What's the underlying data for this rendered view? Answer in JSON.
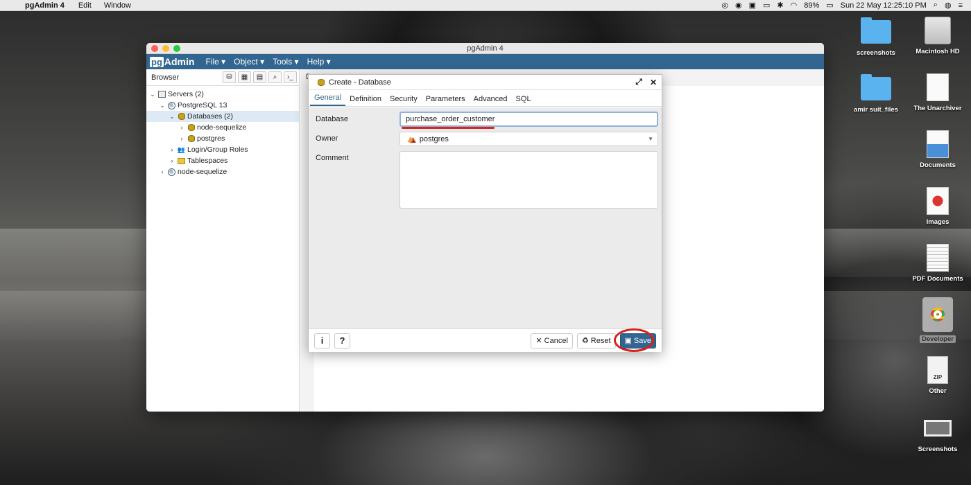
{
  "menubar": {
    "app_name": "pgAdmin 4",
    "menus": [
      "Edit",
      "Window"
    ],
    "battery": "89%",
    "datetime": "Sun 22 May  12:25:10 PM"
  },
  "window": {
    "title": "pgAdmin 4",
    "brand_pg": "pg",
    "brand_rest": "Admin",
    "nav": [
      "File ▾",
      "Object ▾",
      "Tools ▾",
      "Help ▾"
    ]
  },
  "browser": {
    "title": "Browser",
    "tree": [
      {
        "label": "Servers (2)"
      },
      {
        "label": "PostgreSQL 13"
      },
      {
        "label": "Databases (2)"
      },
      {
        "label": "node-sequelize"
      },
      {
        "label": "postgres"
      },
      {
        "label": "Login/Group Roles"
      },
      {
        "label": "Tablespaces"
      },
      {
        "label": "node-sequelize"
      }
    ]
  },
  "main": {
    "tab_label": "D"
  },
  "dialog": {
    "title": "Create - Database",
    "tabs": [
      "General",
      "Definition",
      "Security",
      "Parameters",
      "Advanced",
      "SQL"
    ],
    "active_tab": "General",
    "fields": {
      "database_label": "Database",
      "database_value": "purchase_order_customer",
      "owner_label": "Owner",
      "owner_value": "postgres",
      "comment_label": "Comment"
    },
    "buttons": {
      "info": "i",
      "help": "?",
      "cancel": "Cancel",
      "reset": "Reset",
      "save": "Save"
    },
    "highlight_color": "#e0231c",
    "accent_color": "#326690"
  },
  "desktop": {
    "icons": [
      {
        "label": "screenshots",
        "icon": "folder-icon"
      },
      {
        "label": "Macintosh HD",
        "icon": "hard-drive-icon"
      },
      {
        "label": "amir suit_files",
        "icon": "folder-icon"
      },
      {
        "label": "The Unarchiver",
        "icon": "document-icon"
      },
      {
        "label": "Documents",
        "icon": "document-icon"
      },
      {
        "label": "Images",
        "icon": "image-icon"
      },
      {
        "label": "PDF Documents",
        "icon": "pdf-icon"
      },
      {
        "label": "Developer",
        "icon": "chrome-icon"
      },
      {
        "label": "Other",
        "icon": "zip-icon"
      },
      {
        "label": "Screenshots",
        "icon": "screenshot-icon"
      }
    ]
  }
}
